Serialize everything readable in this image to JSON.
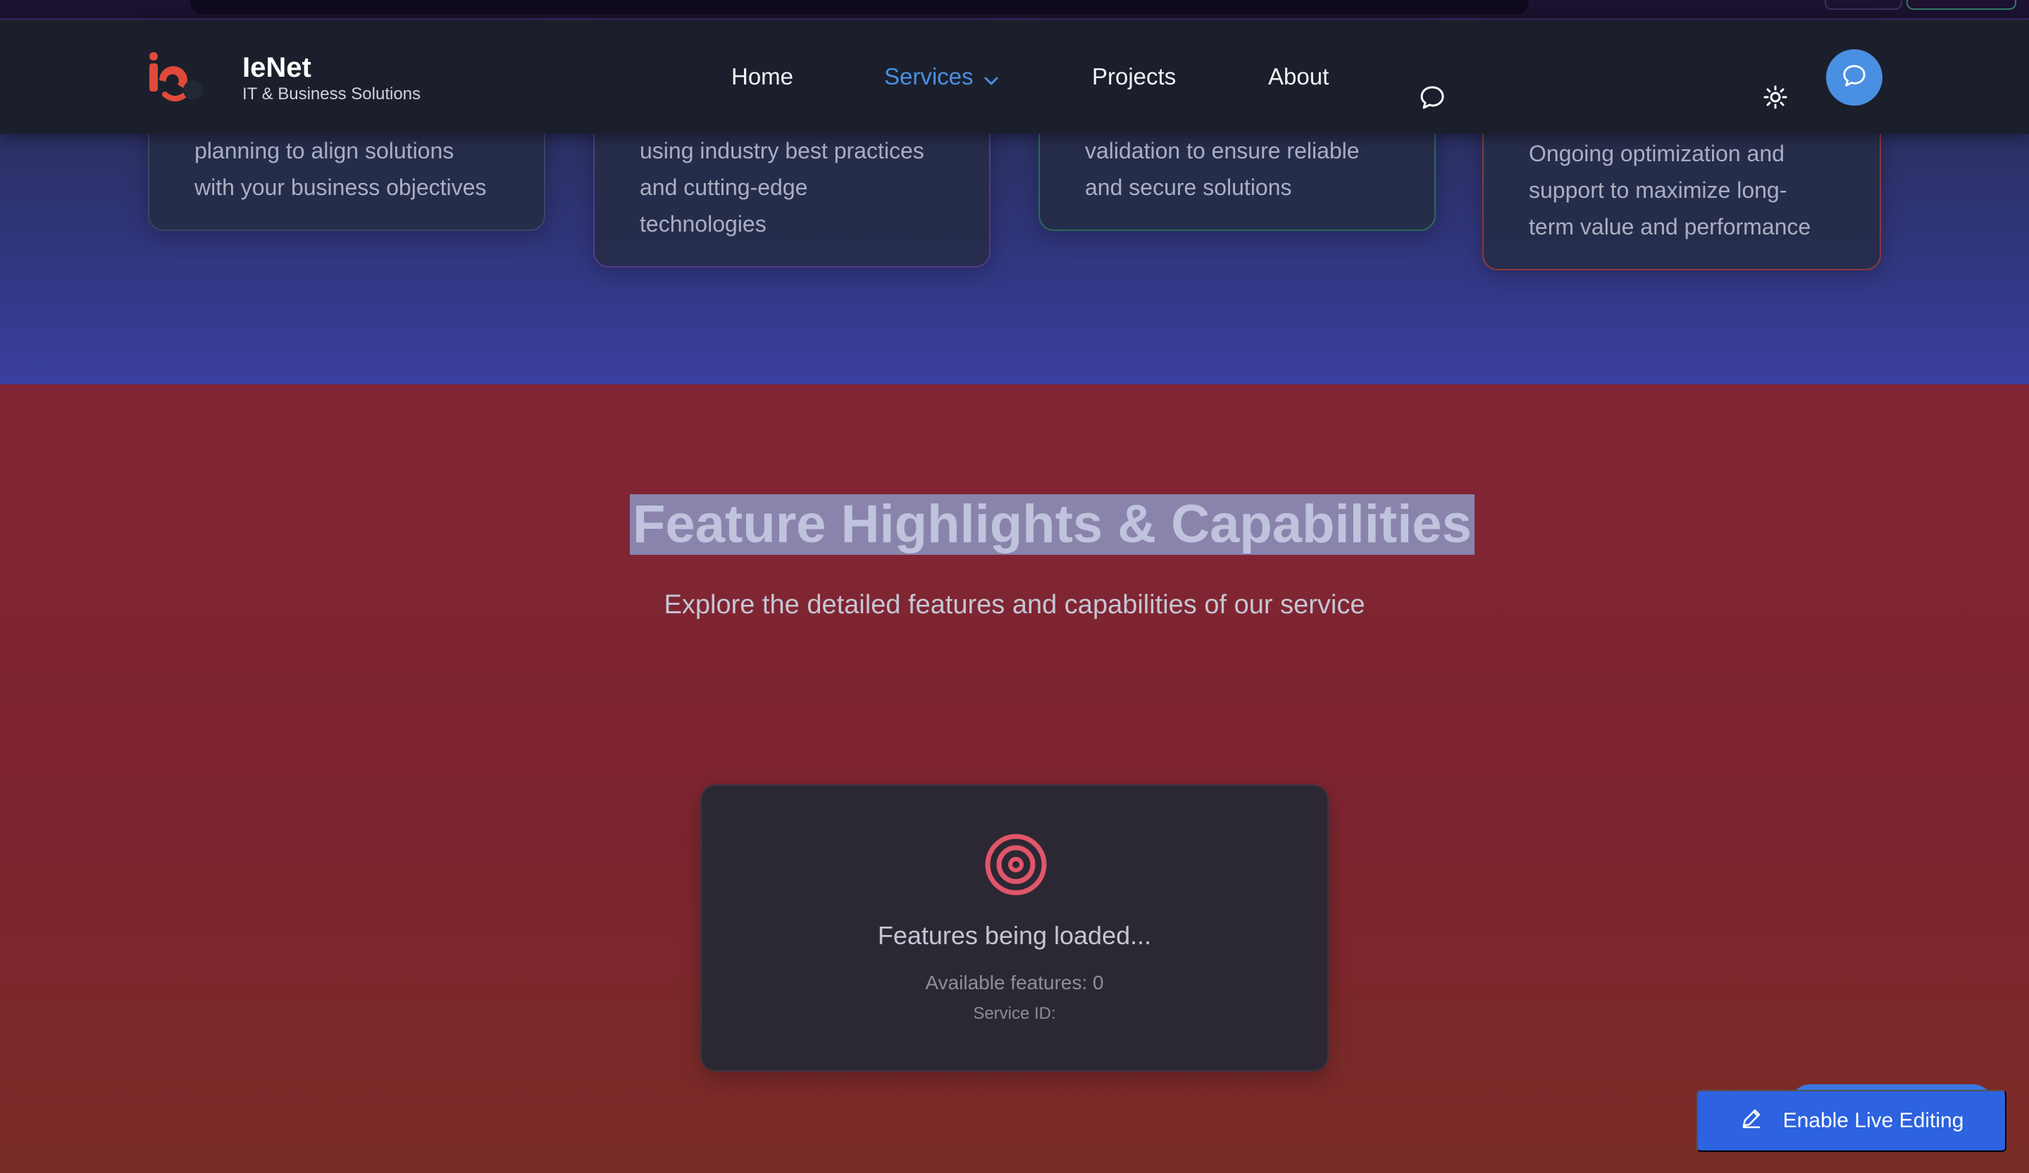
{
  "navbar": {
    "brand_name": "IeNet",
    "brand_tagline": "IT & Business Solutions",
    "items": [
      {
        "label": "Home"
      },
      {
        "label": "Services"
      },
      {
        "label": "Projects"
      },
      {
        "label": "About"
      }
    ],
    "active_item": "Services",
    "icons": [
      "chat-bubble-icon",
      "sun-icon",
      "chat-button-icon"
    ],
    "accent_color": "#4a90e2"
  },
  "process_cards": [
    {
      "text": "planning to align solutions\nwith your business objectives"
    },
    {
      "text": "using industry best practices\nand cutting-edge\ntechnologies"
    },
    {
      "text": "validation to ensure reliable\nand secure solutions"
    },
    {
      "text": "Ongoing optimization and\nsupport to maximize long-\nterm value and performance"
    }
  ],
  "features": {
    "title": "Feature Highlights & Capabilities",
    "subtitle": "Explore the detailed features and capabilities of our service",
    "icon": "target-icon",
    "icon_color": "#e0566a",
    "loading_text": "Features being loaded...",
    "available_text": "Available features: 0",
    "service_id_text": "Service ID:"
  },
  "live_edit_button": {
    "label": "Enable Live Editing",
    "icon": "pencil-icon",
    "color": "#2d62e0"
  }
}
